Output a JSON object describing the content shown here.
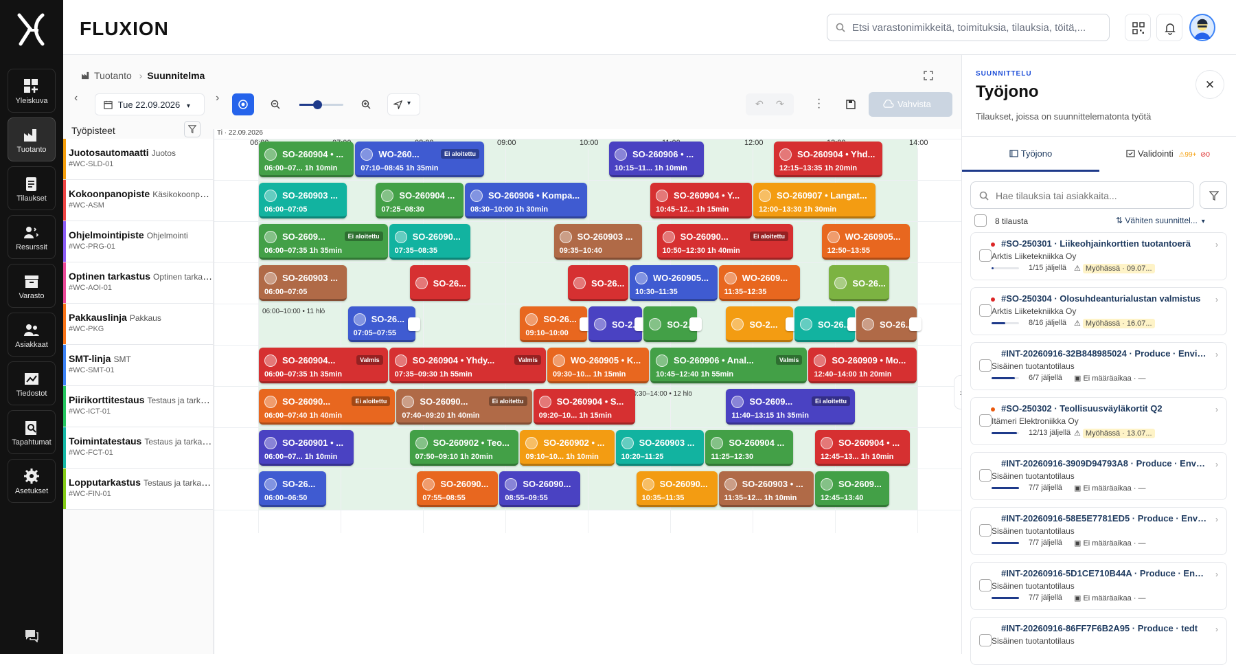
{
  "app": {
    "brand": "FLUXION",
    "search_placeholder": "Etsi varastonimikkeitä, toimituksia, tilauksia, töitä,..."
  },
  "nav": [
    "Yleiskuva",
    "Tuotanto",
    "Tilaukset",
    "Resurssit",
    "Varasto",
    "Asiakkaat",
    "Tiedostot",
    "Tapahtumat",
    "Asetukset"
  ],
  "crumbs": {
    "parent": "Tuotanto",
    "current": "Suunnitelma"
  },
  "toolbar": {
    "date": "Tue 22.09.2026",
    "zoom_level": 0.4,
    "confirm": "Vahvista"
  },
  "grid": {
    "title": "Työpisteet",
    "date_label": "Ti · 22.09.2026",
    "hours": [
      "06:00",
      "07:00",
      "08:00",
      "09:00",
      "10:00",
      "11:00",
      "12:00",
      "13:00",
      "14:00"
    ]
  },
  "workcenters": [
    {
      "name": "Juotosautomaatti",
      "type": "Juotos",
      "code": "#WC-SLD-01",
      "color": "#f59e0b"
    },
    {
      "name": "Kokoonpanopiste",
      "type": "Käsikokoonpano",
      "code": "#WC-ASM",
      "color": "#ef4444"
    },
    {
      "name": "Ohjelmointipiste",
      "type": "Ohjelmointi",
      "code": "#WC-PRG-01",
      "color": "#8b5cf6"
    },
    {
      "name": "Optinen tarkastus",
      "type": "Optinen tarkast...",
      "code": "#WC-AOI-01",
      "color": "#ec4899"
    },
    {
      "name": "Pakkauslinja",
      "type": "Pakkaus",
      "code": "#WC-PKG",
      "color": "#f97316"
    },
    {
      "name": "SMT-linja",
      "type": "SMT",
      "code": "#WC-SMT-01",
      "color": "#3b82f6"
    },
    {
      "name": "Piirikorttitestaus",
      "type": "Testaus ja tarkas...",
      "code": "#WC-ICT-01",
      "color": "#22c55e"
    },
    {
      "name": "Toimintatestaus",
      "type": "Testaus ja tarkas...",
      "code": "#WC-FCT-01",
      "color": "#14b8a6"
    },
    {
      "name": "Lopputarkastus",
      "type": "Testaus ja tarkast...",
      "code": "#WC-FIN-01",
      "color": "#84cc16"
    }
  ],
  "hlo_labels": [
    {
      "row": 4,
      "h": 6.05,
      "text": "06:00–10:00 • 11 hlö"
    },
    {
      "row": 6,
      "h": 10.5,
      "text": "10:30–14:00 • 12 hlö"
    }
  ],
  "blocks": [
    {
      "row": 0,
      "s": 6.0,
      "e": 7.17,
      "c": "#43a047",
      "ti": "SO-260904 • ...",
      "tm": "06:00–07... 1h 10min"
    },
    {
      "row": 0,
      "s": 7.17,
      "e": 8.75,
      "c": "#3f5bd1",
      "ti": "WO-260...",
      "tm": "07:10–08:45  1h 35min",
      "badge": "Ei aloitettu"
    },
    {
      "row": 0,
      "s": 10.25,
      "e": 11.42,
      "c": "#4a42c2",
      "ti": "SO-260906 • ...",
      "tm": "10:15–11...  1h 10min"
    },
    {
      "row": 0,
      "s": 12.25,
      "e": 13.58,
      "c": "#d63031",
      "ti": "SO-260904 • Yhd...",
      "tm": "12:15–13:35  1h 20min"
    },
    {
      "row": 1,
      "s": 6.0,
      "e": 7.08,
      "c": "#12b3a0",
      "ti": "SO-260903 ...",
      "tm": "06:00–07:05"
    },
    {
      "row": 1,
      "s": 7.42,
      "e": 8.5,
      "c": "#43a047",
      "ti": "SO-260904 ...",
      "tm": "07:25–08:30"
    },
    {
      "row": 1,
      "s": 8.5,
      "e": 10.0,
      "c": "#3f5bd1",
      "ti": "SO-260906 • Kompa...",
      "tm": "08:30–10:00  1h 30min"
    },
    {
      "row": 1,
      "s": 10.75,
      "e": 12.0,
      "c": "#d63031",
      "ti": "SO-260904 • Y...",
      "tm": "10:45–12...  1h 15min"
    },
    {
      "row": 1,
      "s": 12.0,
      "e": 13.5,
      "c": "#f39c12",
      "ti": "SO-260907 • Langat...",
      "tm": "12:00–13:30  1h 30min"
    },
    {
      "row": 2,
      "s": 6.0,
      "e": 7.58,
      "c": "#43a047",
      "ti": "SO-2609...",
      "tm": "06:00–07:35  1h 35min",
      "badge": "Ei aloitettu"
    },
    {
      "row": 2,
      "s": 7.58,
      "e": 8.58,
      "c": "#12b3a0",
      "ti": "SO-26090...",
      "tm": "07:35–08:35"
    },
    {
      "row": 2,
      "s": 9.58,
      "e": 10.67,
      "c": "#b06a47",
      "ti": "SO-260903 ...",
      "tm": "09:35–10:40"
    },
    {
      "row": 2,
      "s": 10.83,
      "e": 12.5,
      "c": "#d63031",
      "ti": "SO-26090...",
      "tm": "10:50–12:30  1h 40min",
      "badge": "Ei aloitettu"
    },
    {
      "row": 2,
      "s": 12.83,
      "e": 13.92,
      "c": "#e8671f",
      "ti": "WO-260905...",
      "tm": "12:50–13:55"
    },
    {
      "row": 3,
      "s": 6.0,
      "e": 7.08,
      "c": "#b06a47",
      "ti": "SO-260903 ...",
      "tm": "06:00–07:05"
    },
    {
      "row": 3,
      "s": 7.83,
      "e": 8.58,
      "c": "#d63031",
      "ti": "SO-26..."
    },
    {
      "row": 3,
      "s": 9.75,
      "e": 10.5,
      "c": "#d63031",
      "ti": "SO-26..."
    },
    {
      "row": 3,
      "s": 10.5,
      "e": 11.58,
      "c": "#3f5bd1",
      "ti": "WO-260905...",
      "tm": "10:30–11:35"
    },
    {
      "row": 3,
      "s": 11.58,
      "e": 12.58,
      "c": "#e8671f",
      "ti": "WO-2609...",
      "tm": "11:35–12:35"
    },
    {
      "row": 3,
      "s": 12.92,
      "e": 13.67,
      "c": "#7cb342",
      "ti": "SO-26..."
    },
    {
      "row": 4,
      "s": 7.08,
      "e": 7.92,
      "c": "#3f5bd1",
      "ti": "SO-26...",
      "tm": "07:05–07:55",
      "flag": true
    },
    {
      "row": 4,
      "s": 9.17,
      "e": 10.0,
      "c": "#e8671f",
      "ti": "SO-26...",
      "tm": "09:10–10:00",
      "flag": true
    },
    {
      "row": 4,
      "s": 10.0,
      "e": 10.67,
      "c": "#4a42c2",
      "ti": "SO-2...",
      "flag": true
    },
    {
      "row": 4,
      "s": 10.67,
      "e": 11.33,
      "c": "#43a047",
      "ti": "SO-2...",
      "flag": true
    },
    {
      "row": 4,
      "s": 11.67,
      "e": 12.5,
      "c": "#f39c12",
      "ti": "SO-2...",
      "flag": true
    },
    {
      "row": 4,
      "s": 12.5,
      "e": 13.25,
      "c": "#12b3a0",
      "ti": "SO-26...",
      "flag": true
    },
    {
      "row": 4,
      "s": 13.25,
      "e": 14.0,
      "c": "#b06a47",
      "ti": "SO-26...",
      "flag": true
    },
    {
      "row": 5,
      "s": 6.0,
      "e": 7.58,
      "c": "#d63031",
      "ti": "SO-260904...",
      "tm": "06:00–07:35  1h 35min",
      "badge": "Valmis"
    },
    {
      "row": 5,
      "s": 7.58,
      "e": 9.5,
      "c": "#d63031",
      "ti": "SO-260904 • Yhdy...",
      "tm": "07:35–09:30  1h 55min",
      "badge": "Valmis"
    },
    {
      "row": 5,
      "s": 9.5,
      "e": 10.75,
      "c": "#e8671f",
      "ti": "WO-260905 • K...",
      "tm": "09:30–10...  1h 15min"
    },
    {
      "row": 5,
      "s": 10.75,
      "e": 12.67,
      "c": "#43a047",
      "ti": "SO-260906 • Anal...",
      "tm": "10:45–12:40  1h 55min",
      "badge": "Valmis"
    },
    {
      "row": 5,
      "s": 12.67,
      "e": 14.0,
      "c": "#d63031",
      "ti": "SO-260909 • Mo...",
      "tm": "12:40–14:00  1h 20min"
    },
    {
      "row": 6,
      "s": 6.0,
      "e": 7.67,
      "c": "#e8671f",
      "ti": "SO-26090...",
      "tm": "06:00–07:40  1h 40min",
      "badge": "Ei aloitettu"
    },
    {
      "row": 6,
      "s": 7.67,
      "e": 9.33,
      "c": "#b06a47",
      "ti": "SO-26090...",
      "tm": "07:40–09:20  1h 40min",
      "badge": "Ei aloitettu"
    },
    {
      "row": 6,
      "s": 9.33,
      "e": 10.58,
      "c": "#d63031",
      "ti": "SO-260904 • S...",
      "tm": "09:20–10...  1h 15min"
    },
    {
      "row": 6,
      "s": 11.67,
      "e": 13.25,
      "c": "#4a42c2",
      "ti": "SO-2609...",
      "tm": "11:40–13:15  1h 35min",
      "badge": "Ei aloitettu"
    },
    {
      "row": 7,
      "s": 6.0,
      "e": 7.17,
      "c": "#4a42c2",
      "ti": "SO-260901 • ...",
      "tm": "06:00–07...  1h 10min"
    },
    {
      "row": 7,
      "s": 7.83,
      "e": 9.17,
      "c": "#43a047",
      "ti": "SO-260902 • Teo...",
      "tm": "07:50–09:10  1h 20min"
    },
    {
      "row": 7,
      "s": 9.17,
      "e": 10.33,
      "c": "#f39c12",
      "ti": "SO-260902 • ...",
      "tm": "09:10–10...  1h 10min"
    },
    {
      "row": 7,
      "s": 10.33,
      "e": 11.42,
      "c": "#12b3a0",
      "ti": "SO-260903 ...",
      "tm": "10:20–11:25"
    },
    {
      "row": 7,
      "s": 11.42,
      "e": 12.5,
      "c": "#43a047",
      "ti": "SO-260904 ...",
      "tm": "11:25–12:30"
    },
    {
      "row": 7,
      "s": 12.75,
      "e": 13.92,
      "c": "#d63031",
      "ti": "SO-260904 • ...",
      "tm": "12:45–13...  1h 10min"
    },
    {
      "row": 8,
      "s": 6.0,
      "e": 6.83,
      "c": "#3f5bd1",
      "ti": "SO-26...",
      "tm": "06:00–06:50"
    },
    {
      "row": 8,
      "s": 7.92,
      "e": 8.92,
      "c": "#e8671f",
      "ti": "SO-26090...",
      "tm": "07:55–08:55"
    },
    {
      "row": 8,
      "s": 8.92,
      "e": 9.92,
      "c": "#4a42c2",
      "ti": "SO-26090...",
      "tm": "08:55–09:55"
    },
    {
      "row": 8,
      "s": 10.58,
      "e": 11.58,
      "c": "#f39c12",
      "ti": "SO-26090...",
      "tm": "10:35–11:35"
    },
    {
      "row": 8,
      "s": 11.58,
      "e": 12.75,
      "c": "#b06a47",
      "ti": "SO-260903 • ...",
      "tm": "11:35–12...  1h 10min"
    },
    {
      "row": 8,
      "s": 12.75,
      "e": 13.67,
      "c": "#43a047",
      "ti": "SO-2609...",
      "tm": "12:45–13:40"
    }
  ],
  "panel": {
    "eyebrow": "SUUNNITTELU",
    "title": "Työjono",
    "subtitle": "Tilaukset, joissa on suunnittelematonta työtä",
    "tab1": "Työjono",
    "tab2": "Validointi",
    "tab2_warn": "99+",
    "tab2_err": "0",
    "search_placeholder": "Hae tilauksia tai asiakkaita...",
    "count": "8 tilausta",
    "sort": "Vähiten suunnittel..."
  },
  "orders": [
    {
      "id": "#SO-250301 · Liikeohjainkorttien tuotantoerä",
      "customer": "Arktis Liiketekniikka Oy",
      "left": "1/15 jäljellä",
      "status": "Myöhässä · 09.07...",
      "late": true,
      "dot": "#dc2626",
      "progress": 0.07
    },
    {
      "id": "#SO-250304 · Olosuhdeanturialustan valmistus",
      "customer": "Arktis Liiketekniikka Oy",
      "left": "8/16 jäljellä",
      "status": "Myöhässä · 16.07...",
      "late": true,
      "dot": "#dc2626",
      "progress": 0.5
    },
    {
      "id": "#INT-20260916-32B848985024 · Produce · Envir...",
      "customer": "Sisäinen tuotantotilaus",
      "left": "6/7 jäljellä",
      "status": "Ei määräaikaa · —",
      "late": false,
      "dot": "",
      "progress": 0.86
    },
    {
      "id": "#SO-250302 · Teollisuusväyläkortit Q2",
      "customer": "Itämeri Elektroniikka Oy",
      "left": "12/13 jäljellä",
      "status": "Myöhässä · 13.07...",
      "late": true,
      "dot": "#ea580c",
      "progress": 0.92
    },
    {
      "id": "#INT-20260916-3909D94793A8 · Produce · Envir...",
      "customer": "Sisäinen tuotantotilaus",
      "left": "7/7 jäljellä",
      "status": "Ei määräaikaa · —",
      "late": false,
      "dot": "",
      "progress": 1
    },
    {
      "id": "#INT-20260916-58E5E7781ED5 · Produce · Envir...",
      "customer": "Sisäinen tuotantotilaus",
      "left": "7/7 jäljellä",
      "status": "Ei määräaikaa · —",
      "late": false,
      "dot": "",
      "progress": 1
    },
    {
      "id": "#INT-20260916-5D1CE710B44A · Produce · Envir...",
      "customer": "Sisäinen tuotantotilaus",
      "left": "7/7 jäljellä",
      "status": "Ei määräaikaa · —",
      "late": false,
      "dot": "",
      "progress": 1
    },
    {
      "id": "#INT-20260916-86FF7F6B2A95 · Produce · tedt",
      "customer": "Sisäinen tuotantotilaus",
      "left": "",
      "status": "",
      "late": false,
      "dot": "",
      "progress": 0
    }
  ]
}
